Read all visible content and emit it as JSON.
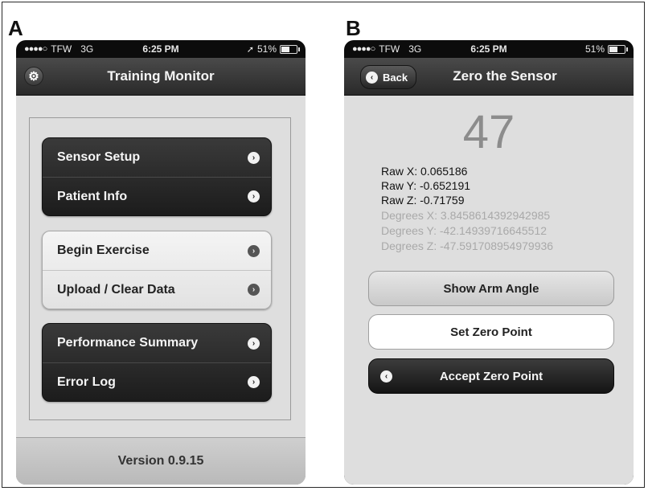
{
  "panels": {
    "a_letter": "A",
    "b_letter": "B"
  },
  "status_bar": {
    "dots": "●●●●○",
    "carrier": "TFW",
    "network": "3G",
    "time": "6:25 PM",
    "a_battery": "51%",
    "b_battery": "51%",
    "location_arrow": "➚"
  },
  "screen_a": {
    "title": "Training Monitor",
    "settings_icon": "gear-icon",
    "group1": [
      "Sensor Setup",
      "Patient Info"
    ],
    "group2": [
      "Begin Exercise",
      "Upload / Clear Data"
    ],
    "group3": [
      "Performance Summary",
      "Error Log"
    ],
    "version": "Version 0.9.15"
  },
  "screen_b": {
    "back_label": "Back",
    "title": "Zero the Sensor",
    "big_value": "47",
    "raw_x": "Raw X: 0.065186",
    "raw_y": "Raw Y: -0.652191",
    "raw_z": "Raw Z: -0.71759",
    "deg_x": "Degrees X: 3.8458614392942985",
    "deg_y": "Degrees Y: -42.14939716645512",
    "deg_z": "Degrees Z: -47.591708954979936",
    "show_arm_angle": "Show Arm Angle",
    "set_zero_point": "Set Zero Point",
    "accept_zero_point": "Accept Zero Point"
  },
  "colors": {
    "bar_dark": "#2a2a2a",
    "content_bg": "#dedede",
    "dim_text": "#a9a9a9"
  }
}
